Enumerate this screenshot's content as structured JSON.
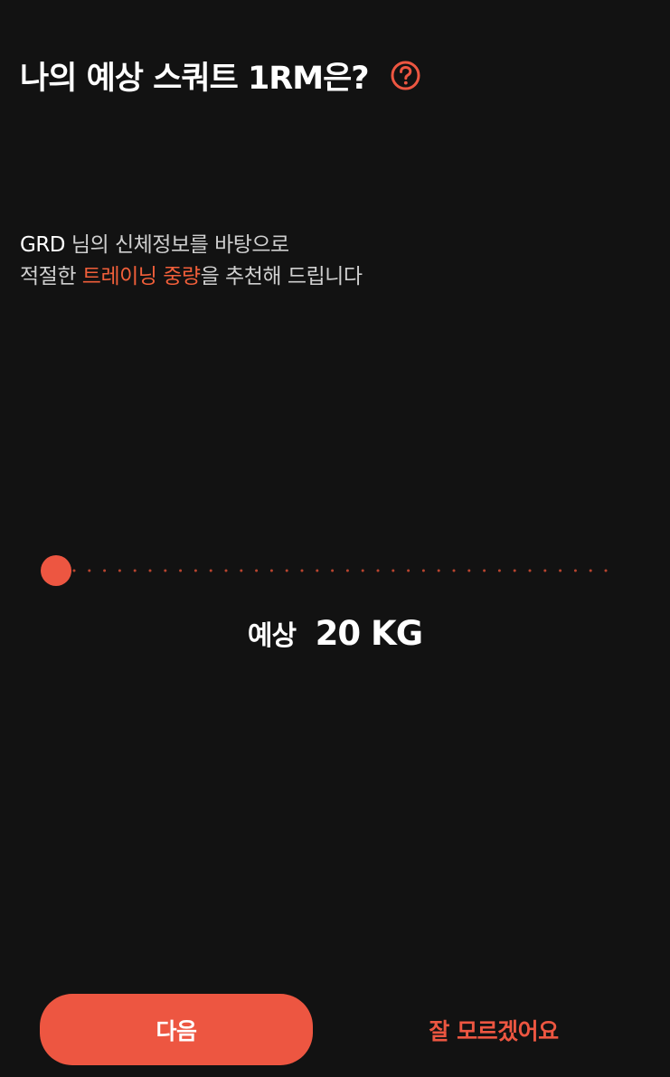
{
  "header": {
    "title": "나의 예상 스쿼트 1RM은?",
    "help_icon": "question-circle-icon"
  },
  "description": {
    "user_name": "GRD",
    "line1_rest": " 님의 신체정보를 바탕으로",
    "line2_prefix": "적절한 ",
    "line2_highlight": "트레이닝 중량",
    "line2_suffix": "을 추천해 드립니다"
  },
  "slider": {
    "value": 20,
    "min": 20,
    "steps": 36
  },
  "estimate": {
    "label": "예상",
    "value_text": "20 KG"
  },
  "actions": {
    "next_label": "다음",
    "unknown_label": "잘 모르겠어요"
  },
  "colors": {
    "background": "#121212",
    "accent": "#ed5641",
    "highlight_text": "#f15f3a"
  }
}
